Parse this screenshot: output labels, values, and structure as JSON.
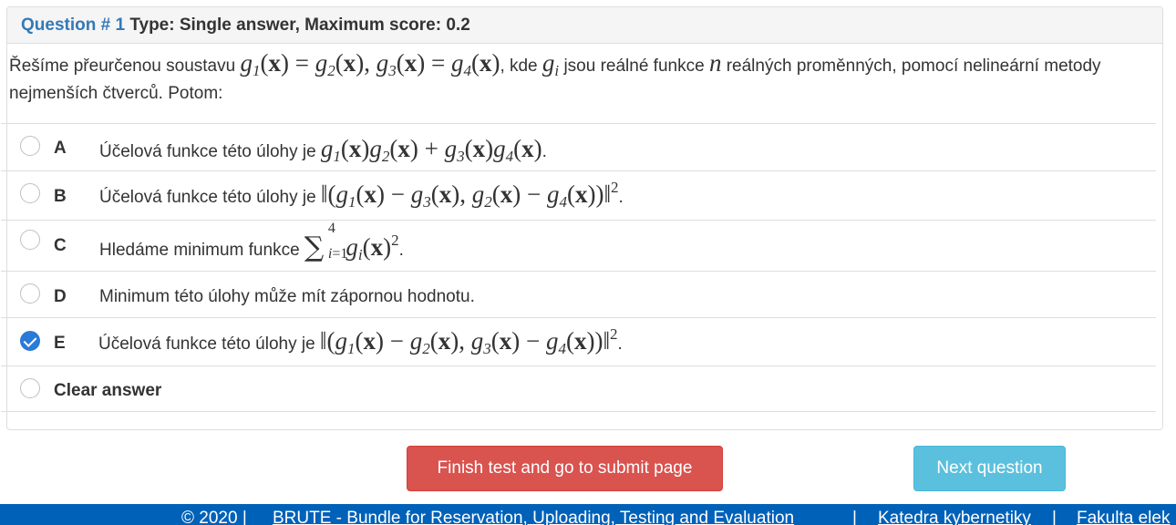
{
  "question": {
    "number_label": "Question # 1",
    "type_label": "Type: Single answer, Maximum score: 0.2",
    "text_part1": "Řešíme přeurčenou soustavu",
    "text_part2": ", kde",
    "text_part3": "jsou reálné funkce",
    "text_part4": "reálných proměnných, pomocí nelineární metody nejmenších čtverců. Potom:"
  },
  "options": [
    {
      "letter": "A",
      "text": "Účelová funkce této úlohy je",
      "selected": false
    },
    {
      "letter": "B",
      "text": "Účelová funkce této úlohy je",
      "selected": false
    },
    {
      "letter": "C",
      "text": "Hledáme minimum funkce",
      "selected": false
    },
    {
      "letter": "D",
      "text": "Minimum této úlohy může mít zápornou hodnotu.",
      "selected": false
    },
    {
      "letter": "E",
      "text": "Účelová funkce této úlohy je",
      "selected": true
    }
  ],
  "clear_answer_label": "Clear answer",
  "buttons": {
    "finish": "Finish test and go to submit page",
    "next": "Next question"
  },
  "footer": {
    "copyright": "© 2020 |",
    "brute": "BRUTE - Bundle for Reservation, Uploading, Testing and Evaluation",
    "sep1": "|",
    "katedra": "Katedra kybernetiky",
    "sep2": "|",
    "fakulta": "Fakulta elek"
  },
  "colors": {
    "question_number": "#337ab7",
    "danger": "#d9534f",
    "info": "#5bc0de",
    "footer_bg": "#0061b8",
    "radio_checked": "#2a7ad7"
  }
}
